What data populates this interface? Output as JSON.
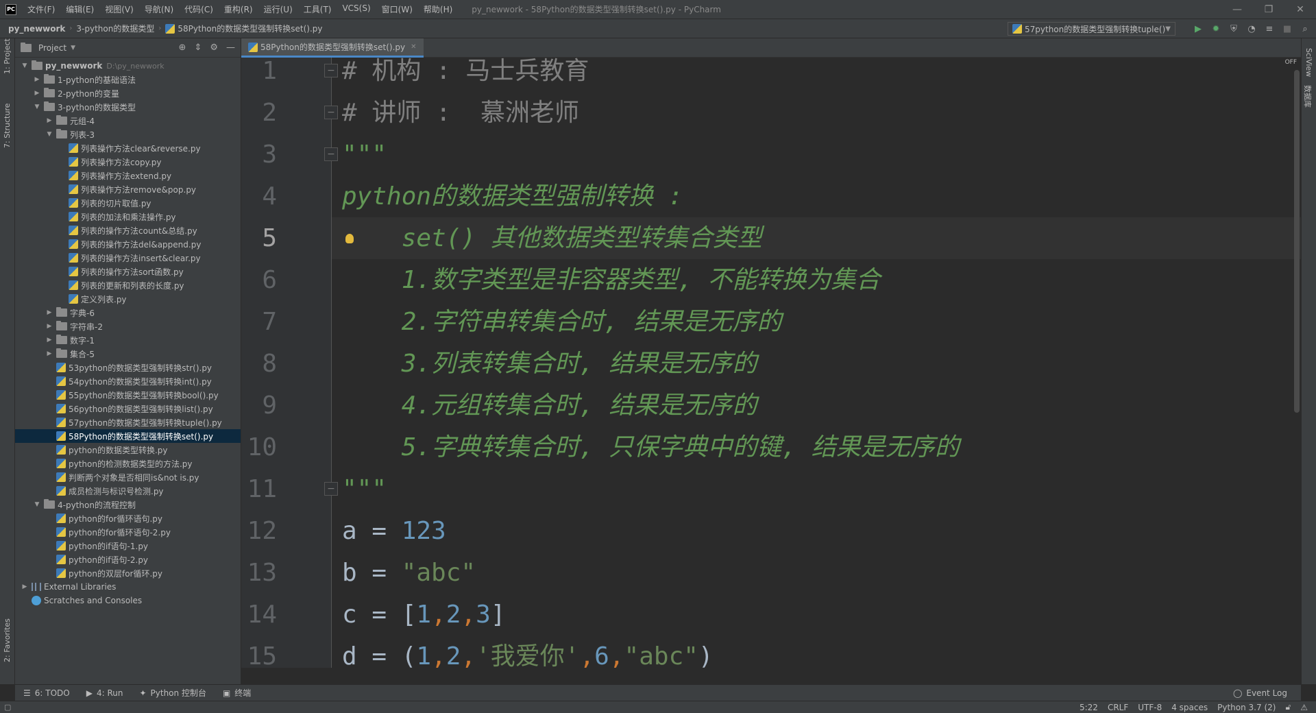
{
  "menu": {
    "items": [
      "文件(F)",
      "编辑(E)",
      "视图(V)",
      "导航(N)",
      "代码(C)",
      "重构(R)",
      "运行(U)",
      "工具(T)",
      "VCS(S)",
      "窗口(W)",
      "帮助(H)"
    ],
    "window_title": "py_newwork - 58Python的数据类型强制转换set().py - PyCharm",
    "logo_text": "PC"
  },
  "breadcrumb": {
    "project": "py_newwork",
    "folder": "3-python的数据类型",
    "file": "58Python的数据类型强制转换set().py"
  },
  "run_config": {
    "label": "57python的数据类型强制转换tuple()"
  },
  "left_strip": {
    "project": "1: Project",
    "structure": "7: Structure",
    "favorites": "2: Favorites"
  },
  "right_strip": {
    "sciview": "SciView",
    "database": "数据库"
  },
  "project_panel": {
    "title": "Project",
    "tree": [
      {
        "label": "py_newwork",
        "path": "D:\\py_newwork",
        "depth": 0,
        "kind": "folder",
        "expanded": true
      },
      {
        "label": "1-python的基础语法",
        "depth": 1,
        "kind": "folder",
        "expanded": false
      },
      {
        "label": "2-python的变量",
        "depth": 1,
        "kind": "folder",
        "expanded": false
      },
      {
        "label": "3-python的数据类型",
        "depth": 1,
        "kind": "folder",
        "expanded": true
      },
      {
        "label": "元组-4",
        "depth": 2,
        "kind": "folder",
        "expanded": false
      },
      {
        "label": "列表-3",
        "depth": 2,
        "kind": "folder",
        "expanded": true
      },
      {
        "label": "列表操作方法clear&reverse.py",
        "depth": 3,
        "kind": "py"
      },
      {
        "label": "列表操作方法copy.py",
        "depth": 3,
        "kind": "py"
      },
      {
        "label": "列表操作方法extend.py",
        "depth": 3,
        "kind": "py"
      },
      {
        "label": "列表操作方法remove&pop.py",
        "depth": 3,
        "kind": "py"
      },
      {
        "label": "列表的切片取值.py",
        "depth": 3,
        "kind": "py"
      },
      {
        "label": "列表的加法和乘法操作.py",
        "depth": 3,
        "kind": "py"
      },
      {
        "label": "列表的操作方法count&总结.py",
        "depth": 3,
        "kind": "py"
      },
      {
        "label": "列表的操作方法del&append.py",
        "depth": 3,
        "kind": "py"
      },
      {
        "label": "列表的操作方法insert&clear.py",
        "depth": 3,
        "kind": "py"
      },
      {
        "label": "列表的操作方法sort函数.py",
        "depth": 3,
        "kind": "py"
      },
      {
        "label": "列表的更新和列表的长度.py",
        "depth": 3,
        "kind": "py"
      },
      {
        "label": "定义列表.py",
        "depth": 3,
        "kind": "py"
      },
      {
        "label": "字典-6",
        "depth": 2,
        "kind": "folder",
        "expanded": false
      },
      {
        "label": "字符串-2",
        "depth": 2,
        "kind": "folder",
        "expanded": false
      },
      {
        "label": "数字-1",
        "depth": 2,
        "kind": "folder",
        "expanded": false
      },
      {
        "label": "集合-5",
        "depth": 2,
        "kind": "folder",
        "expanded": false
      },
      {
        "label": "53python的数据类型强制转换str().py",
        "depth": 2,
        "kind": "py"
      },
      {
        "label": "54python的数据类型强制转换int().py",
        "depth": 2,
        "kind": "py"
      },
      {
        "label": "55python的数据类型强制转换bool().py",
        "depth": 2,
        "kind": "py"
      },
      {
        "label": "56python的数据类型强制转换list().py",
        "depth": 2,
        "kind": "py"
      },
      {
        "label": "57python的数据类型强制转换tuple().py",
        "depth": 2,
        "kind": "py"
      },
      {
        "label": "58Python的数据类型强制转换set().py",
        "depth": 2,
        "kind": "py",
        "selected": true
      },
      {
        "label": "python的数据类型转换.py",
        "depth": 2,
        "kind": "py"
      },
      {
        "label": "python的检测数据类型的方法.py",
        "depth": 2,
        "kind": "py"
      },
      {
        "label": "判断两个对象是否相同is&not is.py",
        "depth": 2,
        "kind": "py"
      },
      {
        "label": "成员检测与标识号检测.py",
        "depth": 2,
        "kind": "py"
      },
      {
        "label": "4-python的流程控制",
        "depth": 1,
        "kind": "folder",
        "expanded": true
      },
      {
        "label": "python的for循环语句.py",
        "depth": 2,
        "kind": "py"
      },
      {
        "label": "python的for循环语句-2.py",
        "depth": 2,
        "kind": "py"
      },
      {
        "label": "python的if语句-1.py",
        "depth": 2,
        "kind": "py"
      },
      {
        "label": "python的if语句-2.py",
        "depth": 2,
        "kind": "py"
      },
      {
        "label": "python的双层for循环.py",
        "depth": 2,
        "kind": "py"
      },
      {
        "label": "External Libraries",
        "depth": 0,
        "kind": "lib",
        "expanded": false
      },
      {
        "label": "Scratches and Consoles",
        "depth": 0,
        "kind": "scratch"
      }
    ]
  },
  "editor": {
    "tab_label": "58Python的数据类型强制转换set().py",
    "current_line": 5,
    "inspection": "OFF",
    "lines": [
      {
        "n": "1",
        "parts": [
          {
            "t": "# 机构 : 马士兵教育",
            "c": "cm"
          }
        ]
      },
      {
        "n": "2",
        "parts": [
          {
            "t": "# 讲师 :  慕洲老师",
            "c": "cm"
          }
        ]
      },
      {
        "n": "3",
        "parts": [
          {
            "t": "\"\"\"",
            "c": "doc"
          }
        ]
      },
      {
        "n": "4",
        "parts": [
          {
            "t": "python的数据类型强制转换 :",
            "c": "doc"
          }
        ]
      },
      {
        "n": "5",
        "parts": [
          {
            "t": "    set() 其他数据类型转集合类型",
            "c": "doc"
          }
        ]
      },
      {
        "n": "6",
        "parts": [
          {
            "t": "    1.数字类型是非容器类型, 不能转换为集合",
            "c": "doc"
          }
        ]
      },
      {
        "n": "7",
        "parts": [
          {
            "t": "    2.字符串转集合时, 结果是无序的",
            "c": "doc"
          }
        ]
      },
      {
        "n": "8",
        "parts": [
          {
            "t": "    3.列表转集合时, 结果是无序的",
            "c": "doc"
          }
        ]
      },
      {
        "n": "9",
        "parts": [
          {
            "t": "    4.元组转集合时, 结果是无序的",
            "c": "doc"
          }
        ]
      },
      {
        "n": "10",
        "parts": [
          {
            "t": "    5.字典转集合时, 只保字典中的键, 结果是无序的",
            "c": "doc"
          }
        ]
      },
      {
        "n": "11",
        "parts": [
          {
            "t": "\"\"\"",
            "c": "doc"
          }
        ]
      },
      {
        "n": "12",
        "parts": [
          {
            "t": "a = ",
            "c": ""
          },
          {
            "t": "123",
            "c": "num"
          }
        ]
      },
      {
        "n": "13",
        "parts": [
          {
            "t": "b = ",
            "c": ""
          },
          {
            "t": "\"abc\"",
            "c": "str"
          }
        ]
      },
      {
        "n": "14",
        "parts": [
          {
            "t": "c = [",
            "c": ""
          },
          {
            "t": "1",
            "c": "num"
          },
          {
            "t": ",",
            "c": "op"
          },
          {
            "t": "2",
            "c": "num"
          },
          {
            "t": ",",
            "c": "op"
          },
          {
            "t": "3",
            "c": "num"
          },
          {
            "t": "]",
            "c": ""
          }
        ]
      },
      {
        "n": "15",
        "parts": [
          {
            "t": "d = (",
            "c": ""
          },
          {
            "t": "1",
            "c": "num"
          },
          {
            "t": ",",
            "c": "op"
          },
          {
            "t": "2",
            "c": "num"
          },
          {
            "t": ",",
            "c": "op"
          },
          {
            "t": "'我爱你'",
            "c": "str"
          },
          {
            "t": ",",
            "c": "op"
          },
          {
            "t": "6",
            "c": "num"
          },
          {
            "t": ",",
            "c": "op"
          },
          {
            "t": "\"abc\"",
            "c": "str"
          },
          {
            "t": ")",
            "c": ""
          }
        ]
      }
    ]
  },
  "toolwindows": {
    "todo": "6: TODO",
    "run": "4: Run",
    "console": "Python 控制台",
    "terminal": "终端",
    "event_log": "Event Log"
  },
  "status": {
    "position": "5:22",
    "line_sep": "CRLF",
    "encoding": "UTF-8",
    "indent": "4 spaces",
    "interpreter": "Python 3.7 (2)"
  }
}
